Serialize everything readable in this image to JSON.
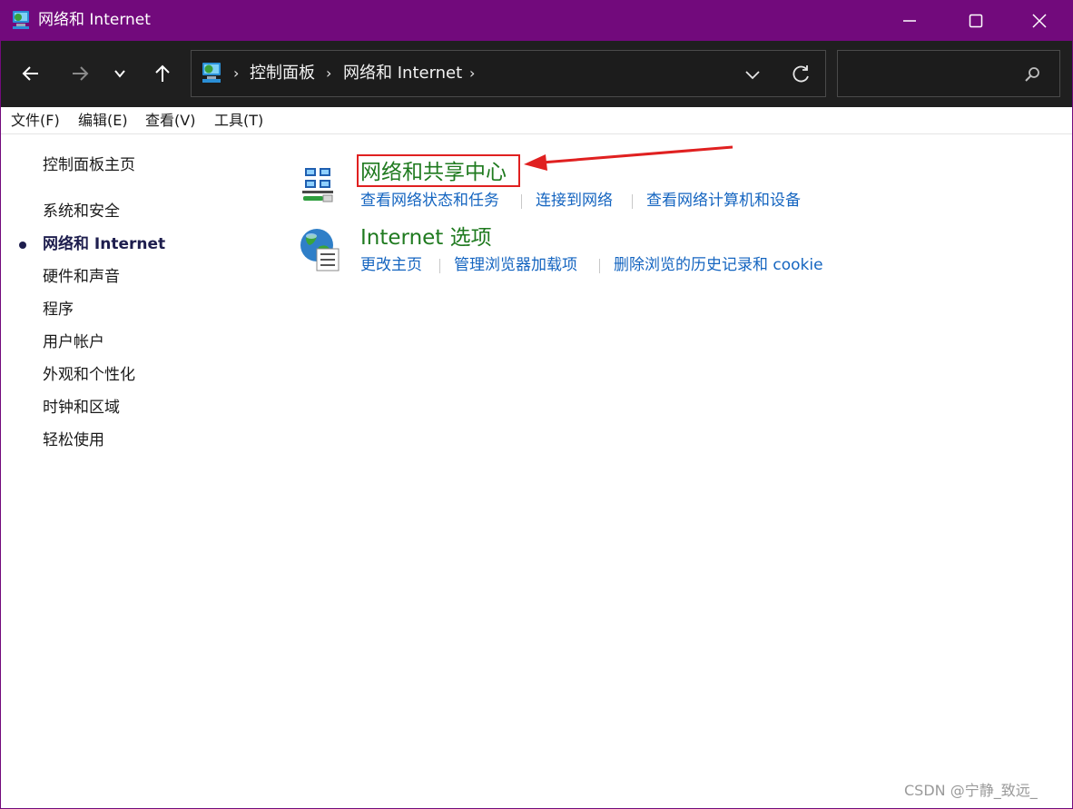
{
  "window": {
    "title": "网络和 Internet",
    "controls": {
      "minimize": "minimize-icon",
      "maximize": "maximize-icon",
      "close": "close-icon"
    }
  },
  "nav": {
    "back_icon": "back-arrow-icon",
    "forward_icon": "forward-arrow-icon",
    "recent_icon": "chevron-down-icon",
    "up_icon": "up-arrow-icon"
  },
  "address": {
    "breadcrumbs": [
      "控制面板",
      "网络和 Internet"
    ],
    "separator": "›",
    "dropdown_icon": "chevron-down-icon",
    "refresh_icon": "refresh-icon"
  },
  "search": {
    "value": "",
    "icon": "search-icon"
  },
  "menu": [
    "文件(F)",
    "编辑(E)",
    "查看(V)",
    "工具(T)"
  ],
  "sidebar": {
    "home": "控制面板主页",
    "items": [
      "系统和安全",
      "网络和 Internet",
      "硬件和声音",
      "程序",
      "用户帐户",
      "外观和个性化",
      "时钟和区域",
      "轻松使用"
    ],
    "current_index": 1
  },
  "categories": [
    {
      "title": "网络和共享中心",
      "icon": "network-sharing-icon",
      "tasks": [
        "查看网络状态和任务",
        "连接到网络",
        "查看网络计算机和设备"
      ]
    },
    {
      "title": "Internet 选项",
      "icon": "internet-options-globe-icon",
      "tasks": [
        "更改主页",
        "管理浏览器加载项",
        "删除浏览的历史记录和 cookie"
      ]
    }
  ],
  "annotation": {
    "color": "#e02020"
  },
  "colors": {
    "titlebar": "#720a7c",
    "navbar": "#1f1f1f",
    "category_title": "#1f7a1f",
    "task_link": "#1565c0"
  },
  "watermark": "CSDN @宁静_致远_"
}
